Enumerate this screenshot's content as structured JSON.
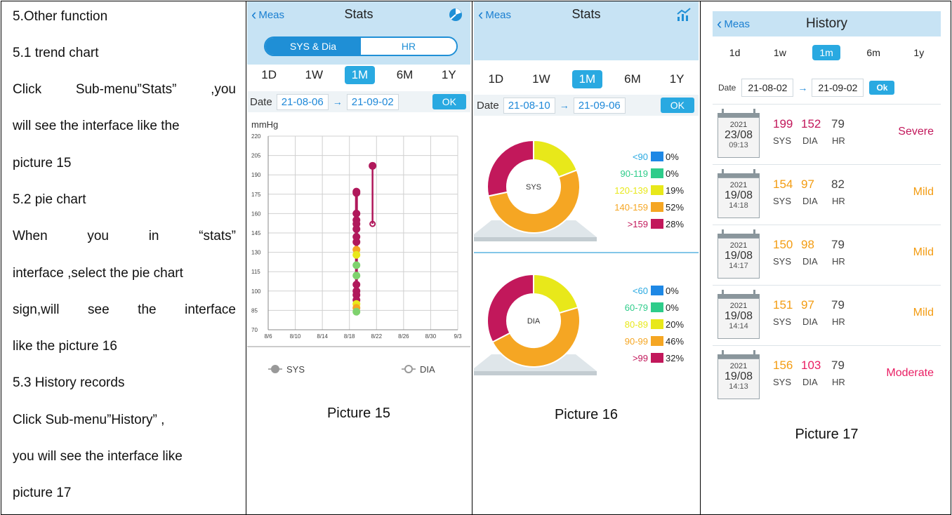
{
  "manual": {
    "lines": [
      "5.Other function",
      "5.1 trend chart",
      [
        "Click",
        "Sub-menu”Stats”",
        ",you"
      ],
      "will see the interface like the",
      "picture 15",
      "5.2 pie chart",
      [
        "When",
        "you",
        "in",
        "“stats”"
      ],
      "interface ,select the pie chart",
      [
        "sign,will",
        "see",
        "the",
        "interface"
      ],
      "like the picture 16",
      "5.3 History records",
      "Click Sub-menu”History” ,",
      "you will see the interface like",
      "picture 17"
    ]
  },
  "screens": {
    "stats_trend": {
      "back_label": "Meas",
      "title": "Stats",
      "segments": [
        "SYS & Dia",
        "HR"
      ],
      "periods": [
        "1D",
        "1W",
        "1M",
        "6M",
        "1Y"
      ],
      "selected_period": "1M",
      "date_label": "Date",
      "date_from": "21-08-06",
      "date_to": "21-09-02",
      "ok_label": "OK",
      "caption": "Picture 15",
      "icon": "pie-chart-icon"
    },
    "stats_pie": {
      "back_label": "Meas",
      "title": "Stats",
      "periods": [
        "1D",
        "1W",
        "1M",
        "6M",
        "1Y"
      ],
      "selected_period": "1M",
      "date_label": "Date",
      "date_from": "21-08-10",
      "date_to": "21-09-06",
      "ok_label": "OK",
      "caption": "Picture 16",
      "icon": "trend-chart-icon"
    },
    "history": {
      "back_label": "Meas",
      "title": "History",
      "periods": [
        "1d",
        "1w",
        "1m",
        "6m",
        "1y"
      ],
      "selected_period": "1m",
      "date_label": "Date",
      "date_from": "21-08-02",
      "date_to": "21-09-02",
      "ok_label": "Ok",
      "caption": "Picture 17",
      "labels": {
        "sys": "SYS",
        "dia": "DIA",
        "hr": "HR"
      },
      "records": [
        {
          "year": "2021",
          "date": "23/08",
          "time": "09:13",
          "sys": "199",
          "dia": "152",
          "hr": "79",
          "level": "Severe",
          "sys_color": "#c2185b",
          "dia_color": "#c2185b",
          "level_color": "#c2185b"
        },
        {
          "year": "2021",
          "date": "19/08",
          "time": "14:18",
          "sys": "154",
          "dia": "97",
          "hr": "82",
          "level": "Mild",
          "sys_color": "#f39c12",
          "dia_color": "#f39c12",
          "level_color": "#f39c12"
        },
        {
          "year": "2021",
          "date": "19/08",
          "time": "14:17",
          "sys": "150",
          "dia": "98",
          "hr": "79",
          "level": "Mild",
          "sys_color": "#f39c12",
          "dia_color": "#f39c12",
          "level_color": "#f39c12"
        },
        {
          "year": "2021",
          "date": "19/08",
          "time": "14:14",
          "sys": "151",
          "dia": "97",
          "hr": "79",
          "level": "Mild",
          "sys_color": "#f39c12",
          "dia_color": "#f39c12",
          "level_color": "#f39c12"
        },
        {
          "year": "2021",
          "date": "19/08",
          "time": "14:13",
          "sys": "156",
          "dia": "103",
          "hr": "79",
          "level": "Moderate",
          "sys_color": "#f39c12",
          "dia_color": "#e91e63",
          "level_color": "#e91e63"
        }
      ]
    }
  },
  "chart_data": [
    {
      "type": "line",
      "ylabel": "mmHg",
      "yticks": [
        70,
        85,
        100,
        115,
        130,
        145,
        160,
        175,
        190,
        205,
        220
      ],
      "ylim": [
        70,
        220
      ],
      "xticks": [
        "8/6",
        "8/10",
        "8/14",
        "8/18",
        "8/22",
        "8/26",
        "8/30",
        "9/3"
      ],
      "grid": true,
      "legend": [
        "SYS",
        "DIA"
      ],
      "series": [
        {
          "name": "SYS",
          "x": "8/18",
          "points": [
            177,
            176,
            160,
            155,
            152,
            148,
            142,
            138
          ]
        },
        {
          "name": "DIA",
          "x": "8/18",
          "points": [
            132,
            128,
            120,
            112,
            105,
            100,
            97,
            93,
            90,
            87,
            84
          ]
        },
        {
          "name": "SYS",
          "x": "8/21",
          "points": [
            197
          ]
        },
        {
          "name": "DIA",
          "x": "8/21",
          "points": [
            152
          ]
        }
      ]
    },
    {
      "type": "pie",
      "center_label": "SYS",
      "slices": [
        {
          "label": "<90",
          "value": 0,
          "color": "#1e88e5",
          "text_color": "#29a9e1"
        },
        {
          "label": "90-119",
          "value": 0,
          "color": "#2ecc8a",
          "text_color": "#2ecc8a"
        },
        {
          "label": "120-139",
          "value": 19,
          "color": "#e8e81a",
          "text_color": "#e8e81a"
        },
        {
          "label": "140-159",
          "value": 52,
          "color": "#f5a623",
          "text_color": "#f5a623"
        },
        {
          "label": ">159",
          "value": 28,
          "color": "#c2185b",
          "text_color": "#c2185b"
        }
      ]
    },
    {
      "type": "pie",
      "center_label": "DIA",
      "slices": [
        {
          "label": "<60",
          "value": 0,
          "color": "#1e88e5",
          "text_color": "#29a9e1"
        },
        {
          "label": "60-79",
          "value": 0,
          "color": "#2ecc8a",
          "text_color": "#2ecc8a"
        },
        {
          "label": "80-89",
          "value": 20,
          "color": "#e8e81a",
          "text_color": "#e8e81a"
        },
        {
          "label": "90-99",
          "value": 46,
          "color": "#f5a623",
          "text_color": "#f5a623"
        },
        {
          "label": ">99",
          "value": 32,
          "color": "#c2185b",
          "text_color": "#c2185b"
        }
      ]
    }
  ]
}
